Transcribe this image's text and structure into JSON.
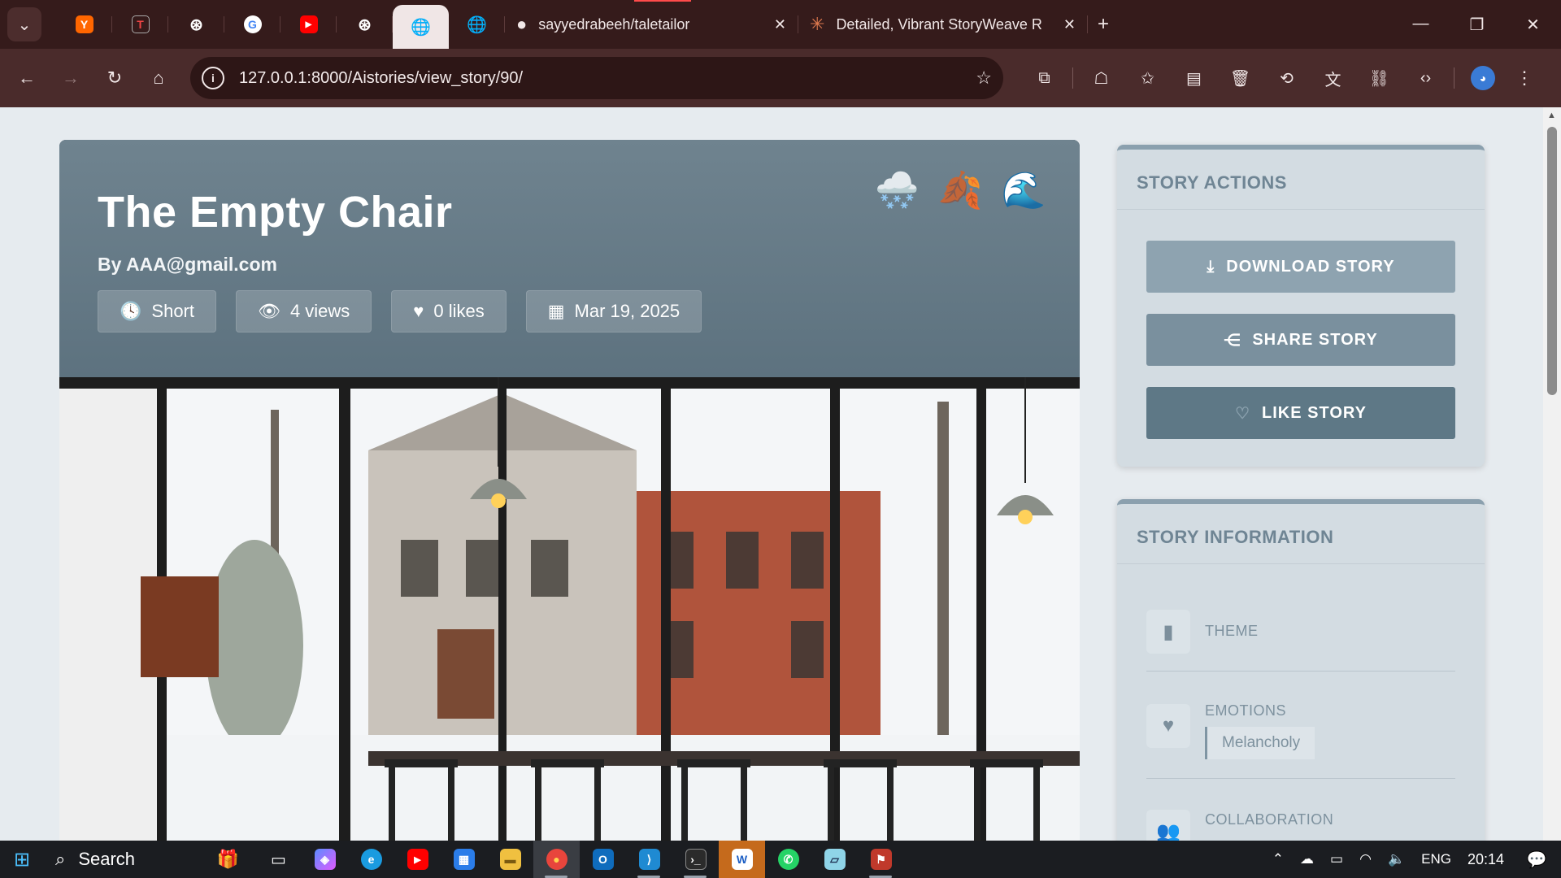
{
  "browser": {
    "tabs": [
      {
        "title": "sayyedrabeeh/taletailor",
        "icon": "github-icon"
      },
      {
        "title": "Detailed, Vibrant StoryWeave R",
        "icon": "claude-icon"
      }
    ],
    "url": "127.0.0.1:8000/Aistories/view_story/90/"
  },
  "story": {
    "title": "The Empty Chair",
    "byline": "By AAA@gmail.com",
    "meta": {
      "length": "Short",
      "views": "4 views",
      "likes": "0 likes",
      "date": "Mar 19, 2025"
    },
    "weather_icons": [
      "🌨️",
      "🍂",
      "🌊"
    ]
  },
  "actions": {
    "heading": "STORY ACTIONS",
    "download": "DOWNLOAD STORY",
    "share": "SHARE STORY",
    "like": "LIKE STORY"
  },
  "info": {
    "heading": "STORY INFORMATION",
    "theme_label": "THEME",
    "emotions_label": "EMOTIONS",
    "emotion_tag": "Melancholy",
    "collaboration_label": "COLLABORATION"
  },
  "taskbar": {
    "search_placeholder": "Search",
    "language": "ENG",
    "time": "20:14"
  },
  "colors": {
    "chrome_dark": "#351b1b",
    "chrome_toolbar": "#4a2b2b",
    "hero": "#6a7e8b",
    "accent": "#5e7886"
  }
}
